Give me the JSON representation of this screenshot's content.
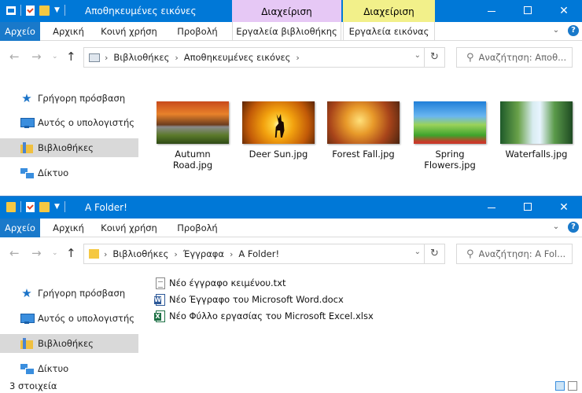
{
  "window1": {
    "title": "Αποθηκευμένες εικόνες",
    "context_tabs": [
      {
        "label": "Διαχείριση",
        "color": "#e6c8f5"
      },
      {
        "label": "Διαχείριση",
        "color": "#f2f08a"
      }
    ],
    "ribbon": {
      "file": "Αρχείο",
      "tabs": [
        "Αρχική",
        "Κοινή χρήση",
        "Προβολή"
      ],
      "ctx_tabs": [
        "Εργαλεία βιβλιοθήκης",
        "Εργαλεία εικόνας"
      ]
    },
    "breadcrumb": [
      "Βιβλιοθήκες",
      "Αποθηκευμένες εικόνες"
    ],
    "search_placeholder": "Αναζήτηση: Αποθ...",
    "nav": [
      "Γρήγορη πρόσβαση",
      "Αυτός ο υπολογιστής",
      "Βιβλιοθήκες",
      "Δίκτυο"
    ],
    "thumbnails": [
      {
        "label": "Autumn Road.jpg",
        "line1": "Autumn",
        "line2": "Road.jpg"
      },
      {
        "label": "Deer Sun.jpg",
        "line1": "Deer Sun.jpg",
        "line2": ""
      },
      {
        "label": "Forest Fall.jpg",
        "line1": "Forest Fall.jpg",
        "line2": ""
      },
      {
        "label": "Spring Flowers.jpg",
        "line1": "Spring",
        "line2": "Flowers.jpg"
      },
      {
        "label": "Waterfalls.jpg",
        "line1": "Waterfalls.jpg",
        "line2": ""
      }
    ]
  },
  "window2": {
    "title": "A Folder!",
    "ribbon": {
      "file": "Αρχείο",
      "tabs": [
        "Αρχική",
        "Κοινή χρήση",
        "Προβολή"
      ]
    },
    "breadcrumb": [
      "Βιβλιοθήκες",
      "Έγγραφα",
      "A Folder!"
    ],
    "search_placeholder": "Αναζήτηση: A Fol...",
    "nav": [
      "Γρήγορη πρόσβαση",
      "Αυτός ο υπολογιστής",
      "Βιβλιοθήκες",
      "Δίκτυο"
    ],
    "files": [
      {
        "name": "Νέο έγγραφο κειμένου.txt",
        "icon": "text-file-icon"
      },
      {
        "name": "Νέο Έγγραφο του Microsoft Word.docx",
        "icon": "word-file-icon"
      },
      {
        "name": "Νέο Φύλλο εργασίας του Microsoft Excel.xlsx",
        "icon": "excel-file-icon"
      }
    ],
    "status": "3 στοιχεία"
  },
  "controls": {
    "minimize": "—",
    "close": "✕"
  }
}
